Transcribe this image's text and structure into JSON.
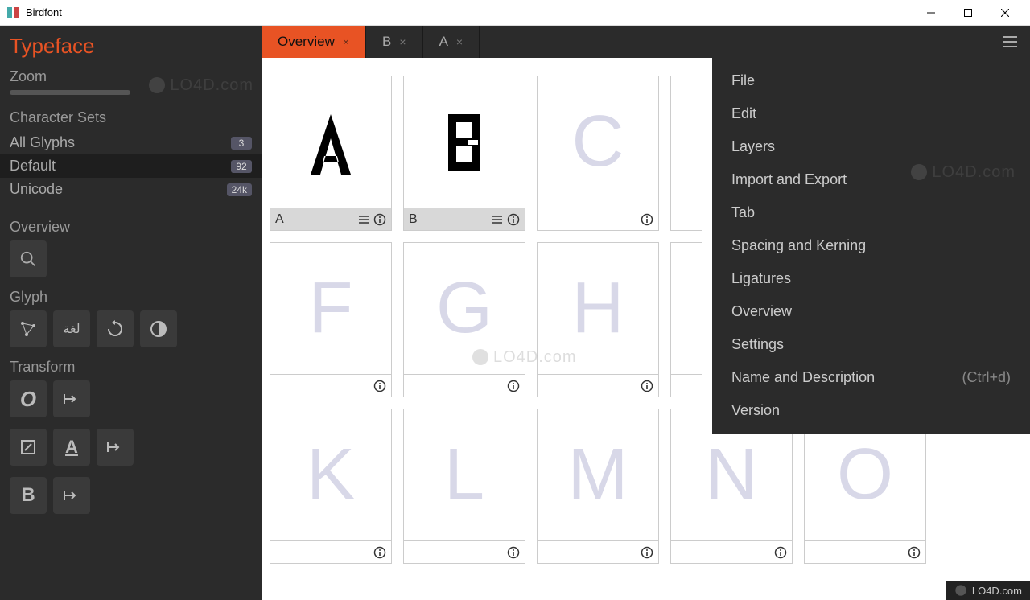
{
  "titlebar": {
    "title": "Birdfont"
  },
  "sidebar": {
    "title": "Typeface",
    "zoom_label": "Zoom",
    "charsets_label": "Character Sets",
    "charsets": [
      {
        "label": "All Glyphs",
        "count": "3"
      },
      {
        "label": "Default",
        "count": "92"
      },
      {
        "label": "Unicode",
        "count": "24k"
      }
    ],
    "overview_label": "Overview",
    "glyph_label": "Glyph",
    "transform_label": "Transform"
  },
  "tabs": [
    {
      "label": "Overview"
    },
    {
      "label": "B"
    },
    {
      "label": "A"
    }
  ],
  "menu": {
    "items": [
      {
        "label": "File",
        "shortcut": ""
      },
      {
        "label": "Edit",
        "shortcut": ""
      },
      {
        "label": "Layers",
        "shortcut": ""
      },
      {
        "label": "Import and Export",
        "shortcut": ""
      },
      {
        "label": "Tab",
        "shortcut": ""
      },
      {
        "label": "Spacing and Kerning",
        "shortcut": ""
      },
      {
        "label": "Ligatures",
        "shortcut": ""
      },
      {
        "label": "Overview",
        "shortcut": ""
      },
      {
        "label": "Settings",
        "shortcut": ""
      },
      {
        "label": "Name and Description",
        "shortcut": "(Ctrl+d)"
      },
      {
        "label": "Version",
        "shortcut": ""
      }
    ]
  },
  "glyphs": {
    "row1": [
      {
        "char": "A",
        "label": "A",
        "designed": true,
        "show_menu": true
      },
      {
        "char": "B",
        "label": "B",
        "designed": true,
        "show_menu": true
      },
      {
        "char": "C",
        "label": "",
        "designed": false,
        "show_menu": false
      },
      {
        "char": "",
        "label": "",
        "designed": false,
        "show_menu": false
      },
      {
        "char": "",
        "label": "",
        "designed": false,
        "show_menu": false
      }
    ],
    "row2": [
      {
        "char": "F",
        "label": "",
        "designed": false
      },
      {
        "char": "G",
        "label": "",
        "designed": false
      },
      {
        "char": "H",
        "label": "",
        "designed": false
      },
      {
        "char": "",
        "label": "",
        "designed": false
      },
      {
        "char": "",
        "label": "",
        "designed": false
      }
    ],
    "row3": [
      {
        "char": "K",
        "label": "",
        "designed": false
      },
      {
        "char": "L",
        "label": "",
        "designed": false
      },
      {
        "char": "M",
        "label": "",
        "designed": false
      },
      {
        "char": "N",
        "label": "",
        "designed": false
      },
      {
        "char": "O",
        "label": "",
        "designed": false
      }
    ]
  },
  "watermark": "LO4D.com"
}
